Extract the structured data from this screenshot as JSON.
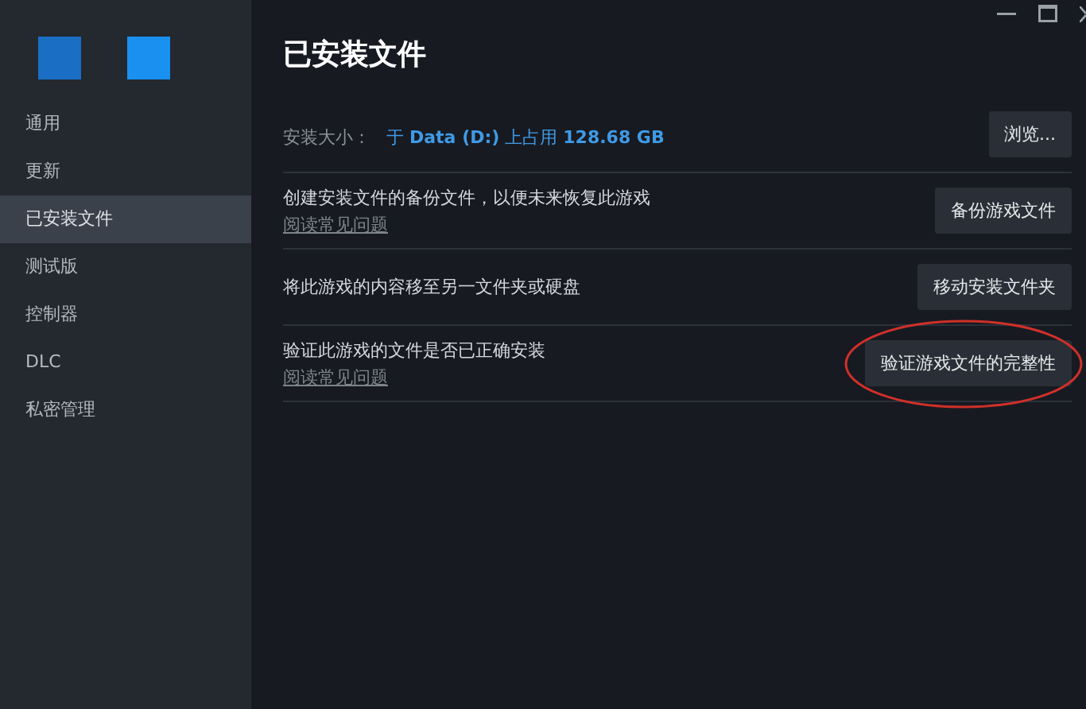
{
  "sidebar": {
    "items": [
      {
        "label": "通用",
        "selected": false
      },
      {
        "label": "更新",
        "selected": false
      },
      {
        "label": "已安装文件",
        "selected": true
      },
      {
        "label": "测试版",
        "selected": false
      },
      {
        "label": "控制器",
        "selected": false
      },
      {
        "label": "DLC",
        "selected": false
      },
      {
        "label": "私密管理",
        "selected": false
      }
    ]
  },
  "page": {
    "title": "已安装文件",
    "install_size": {
      "label": "安装大小：",
      "value": "于 **Data (D:)** 上占用 **128.68 GB**",
      "button": "浏览..."
    },
    "rows": [
      {
        "text": "创建安装文件的备份文件，以便未来恢复此游戏",
        "link": "阅读常见问题",
        "button": "备份游戏文件",
        "circled": false
      },
      {
        "text": "将此游戏的内容移至另一文件夹或硬盘",
        "button": "移动安装文件夹",
        "circled": false
      },
      {
        "text": "验证此游戏的文件是否已正确安装",
        "link": "阅读常见问题",
        "button": "验证游戏文件的完整性",
        "circled": true
      }
    ]
  }
}
